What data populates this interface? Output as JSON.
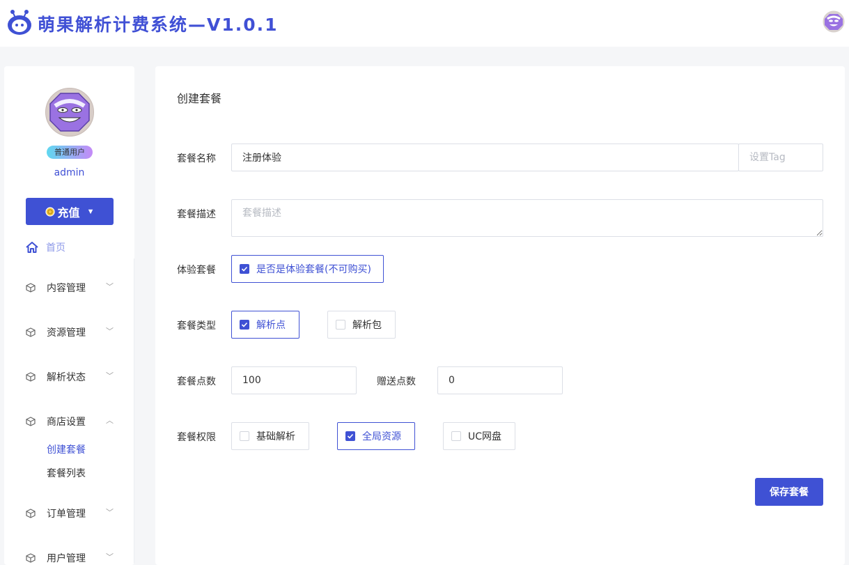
{
  "header": {
    "title": "萌果解析计费系统—V1.0.1"
  },
  "user": {
    "role_badge": "普通用户",
    "username": "admin"
  },
  "sidebar": {
    "recharge_label": "充值",
    "home_label": "首页",
    "menu": [
      {
        "label": "内容管理"
      },
      {
        "label": "资源管理"
      },
      {
        "label": "解析状态"
      },
      {
        "label": "商店设置"
      },
      {
        "label": "订单管理"
      },
      {
        "label": "用户管理"
      }
    ],
    "shop_sub": [
      {
        "label": "创建套餐"
      },
      {
        "label": "套餐列表"
      }
    ]
  },
  "form": {
    "title": "创建套餐",
    "name_label": "套餐名称",
    "name_value": "注册体验",
    "tag_placeholder": "设置Tag",
    "desc_label": "套餐描述",
    "desc_placeholder": "套餐描述",
    "trial_label": "体验套餐",
    "trial_option": "是否是体验套餐(不可购买)",
    "type_label": "套餐类型",
    "type_options": [
      "解析点",
      "解析包"
    ],
    "points_label": "套餐点数",
    "points_value": "100",
    "bonus_label": "赠送点数",
    "bonus_value": "0",
    "perm_label": "套餐权限",
    "perm_options": [
      "基础解析",
      "全局资源",
      "UC网盘"
    ],
    "save_label": "保存套餐"
  },
  "colors": {
    "accent": "#3f51d4",
    "nav_active": "#8c98e8"
  }
}
